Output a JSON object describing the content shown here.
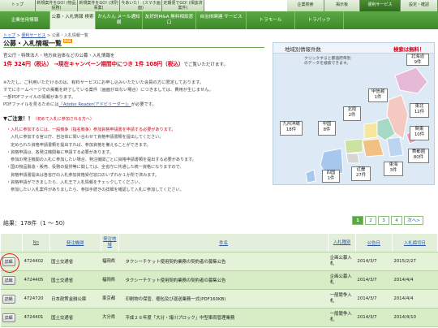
{
  "top_nav": [
    "トップ",
    "新規案件をGO! (物品役務)",
    "新規案件をGO! (求刑事業)",
    "今あいた！ (スマホ画面)",
    "定期便でGO! (相談済案件)",
    "企業検索",
    "掲示板",
    "便利サービス",
    "設定・確認"
  ],
  "sub_nav": [
    "企業信用情報",
    "公募・入札情報 検索",
    "かんたん メール通知網",
    "友好的M&A 無料相談窓口",
    "自治体関連 サービス",
    "トラモール",
    "トラパック"
  ],
  "breadcrumb": {
    "home": "トップ",
    "parent": "便利サービス",
    "current": "公募・入札情報一覧",
    "sep1": ">",
    "sep2": ">"
  },
  "page_title": "公募・入札情報一覧",
  "rss_badge": "RSS",
  "intro": "官公庁・特殊法人・地方自治体などの公募・入札情報を",
  "price": {
    "main": "1件 324円（税込） →現在キャンペーン期間中につき 1件 108円（税込）",
    "tail": "でご覧いただけます。"
  },
  "notes": [
    "※ただし、ご利用いただけるのは、有料サービスにお申し込みいただいた会員の方に限定しております。",
    "すでにホームページでの掲載を終了している案件（画面が出ない場合）につきましては、費用が生じません。",
    "一部PDFファイルの情報があります。",
    "PDFファイルを見るためには"
  ],
  "adobe_link": "『Adobe Reader(アドビリーダー)』",
  "adobe_tail": "が必要です。",
  "caution_title": "▼ご注意！！",
  "caution_sub": "（初めて入札に参加される方へ）",
  "caution_lines": [
    "・入札に参加するには、一般競争（指名競争）参加資格申請書を申請する必要があります。",
    "　入札に参加する官公庁、自治体に問い合わせて資格申請書類を提出してください。",
    "　定められた資格申請書類を提出すれば、参加資格を備えることができます。",
    "・資格申請は、各発注機関毎に申請する必要があります。",
    "　参加の発注機関の入札に参加したい場合、発注機関ごとに資格申請書類を提出する必要があります。",
    "・国の物品製造・販売、役務の提供等に関しては、全省庁に共通した統一資格になりますので、",
    "　資格申請書提出は各省庁の入札参加資格受付窓口のいずれか１か所で済みます。",
    "・資格申請ができましたら、入札王で入札情報をチェックしてください。",
    "　参加したい入札案件がありましたら、参加手続きの詳細を確認して入札に参加してください。"
  ],
  "map": {
    "title": "地域別情報件数",
    "description": "クリックすると都道府県別\nのデータを検索できます。",
    "free_label": "検索は無料！",
    "regions": [
      {
        "name": "北海道",
        "count": "9件"
      },
      {
        "name": "東北",
        "count": "12件"
      },
      {
        "name": "甲信越",
        "count": "1件"
      },
      {
        "name": "北陸",
        "count": "2件"
      },
      {
        "name": "関東",
        "count": "10件"
      },
      {
        "name": "中国",
        "count": "8件"
      },
      {
        "name": "九州沖縄",
        "count": "18件"
      },
      {
        "name": "首都圏",
        "count": "80件"
      },
      {
        "name": "東海",
        "count": "3件"
      },
      {
        "name": "近畿",
        "count": "27件"
      },
      {
        "name": "四国",
        "count": "1件"
      }
    ]
  },
  "results_label": "結果：178件（1 〜 50）",
  "pager": [
    "1",
    "2",
    "3",
    "4",
    "次へ>"
  ],
  "columns": [
    "",
    "No",
    "発注機関",
    "発注地域",
    "件名",
    "入札種別",
    "公告日",
    "入札締切日"
  ],
  "rows": [
    {
      "btn": "詳細",
      "no": "4724402",
      "org": "国土交通省",
      "region": "福岡県",
      "title": "タクシーチケット使用契約業務の契約者の募集公告",
      "kind": "企画公募入札",
      "date": "2014/3/7",
      "deadline": "2015/2/27"
    },
    {
      "btn": "詳細",
      "no": "4724405",
      "org": "国土交通省",
      "region": "福岡県",
      "title": "タクシーチケット使用契約業務の契約者の募集公告",
      "kind": "企画公募入札",
      "date": "2014/3/7",
      "deadline": "2014/4/4"
    },
    {
      "btn": "詳細",
      "no": "4724720",
      "org": "日本政策金融公庫",
      "region": "東京都",
      "title": "印刷物の保管、梱包及び運送業務一式(PDF160KB)",
      "kind": "一般競争入札",
      "date": "2014/3/7",
      "deadline": "2014/4/4"
    },
    {
      "btn": "詳細",
      "no": "4724401",
      "org": "国土交通省",
      "region": "大分県",
      "title": "平成２６年度「大分・諸川ブロック」中型車両管理業務",
      "kind": "一般競争入札",
      "date": "2014/3/7",
      "deadline": "2014/4/10"
    }
  ]
}
